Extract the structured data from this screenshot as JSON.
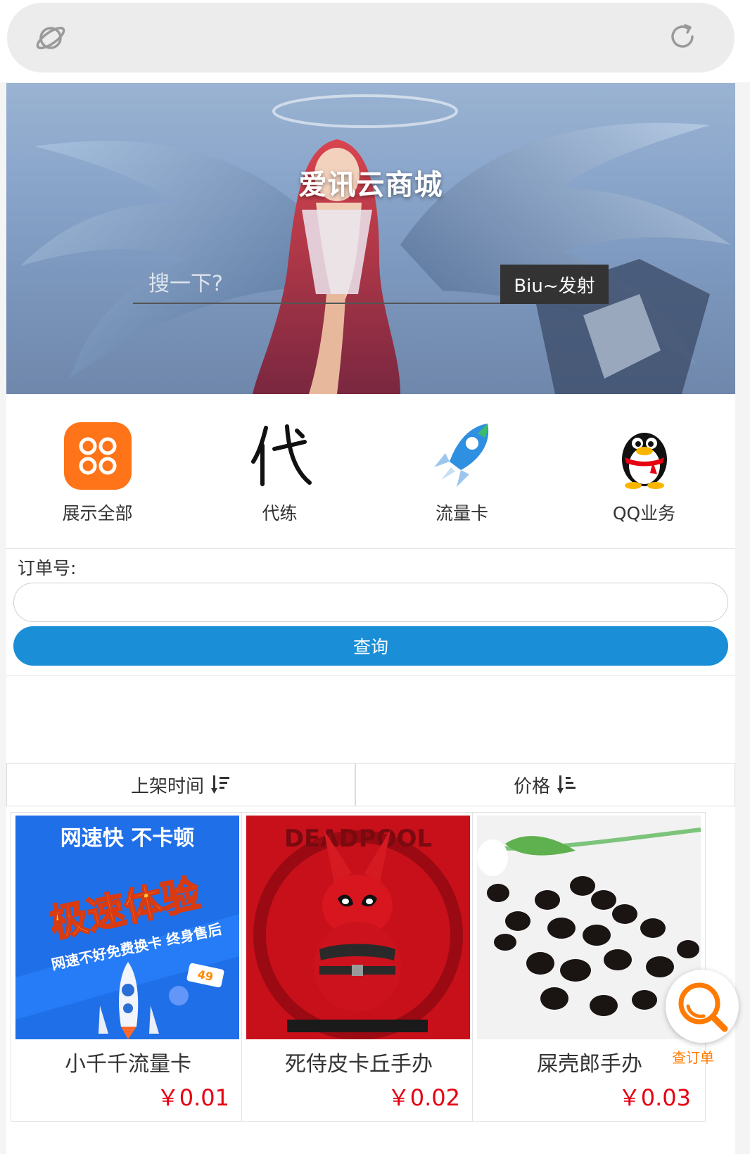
{
  "banner": {
    "site_title": "爱讯云商城",
    "search_placeholder": "搜一下?",
    "search_button": "Biu~发射"
  },
  "categories": [
    {
      "label": "展示全部",
      "icon": "grid-icon"
    },
    {
      "label": "代练",
      "icon": "dai-character-icon"
    },
    {
      "label": "流量卡",
      "icon": "rocket-5g-icon"
    },
    {
      "label": "QQ业务",
      "icon": "penguin-icon"
    }
  ],
  "order": {
    "label": "订单号:",
    "input_value": "",
    "query_button": "查询"
  },
  "sort": {
    "by_time": "上架时间",
    "by_price": "价格"
  },
  "products": [
    {
      "name": "小千千流量卡",
      "price": "￥0.01"
    },
    {
      "name": "死侍皮卡丘手办",
      "price": "￥0.02"
    },
    {
      "name": "屎壳郎手办",
      "price": "￥0.03"
    }
  ],
  "product_images": {
    "flow_card": {
      "line1": "网速快  不卡顿",
      "line2": "极速体验",
      "line3": "网速不好免费换卡 终身售后",
      "badge": "49"
    },
    "deadpool": {
      "title": "DEADPOOL"
    }
  },
  "fab": {
    "label": "查订单"
  },
  "colors": {
    "accent_blue": "#1a8ed7",
    "price_red": "#e60012",
    "orange": "#ff7a00"
  }
}
